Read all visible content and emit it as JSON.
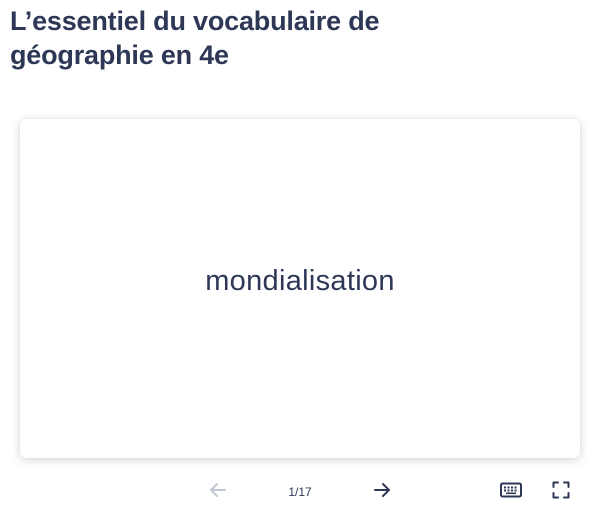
{
  "page": {
    "title": "L’essentiel du vocabulaire de géographie en 4e"
  },
  "card": {
    "term": "mondialisation"
  },
  "controls": {
    "counter": "1/17",
    "current": 1,
    "total": 17,
    "prev_icon": "arrow-left-icon",
    "next_icon": "arrow-right-icon",
    "keyboard_icon": "keyboard-icon",
    "fullscreen_icon": "fullscreen-icon",
    "prev_enabled": false,
    "next_enabled": true
  },
  "colors": {
    "text": "#2e3856",
    "disabled": "#c2c7d6",
    "background": "#ffffff"
  }
}
